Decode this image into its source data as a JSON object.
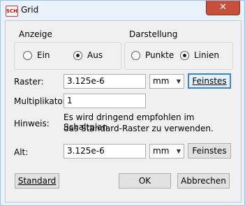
{
  "window": {
    "title": "Grid",
    "app_icon_text": "SCH",
    "close_symbol": "✕"
  },
  "anzeige": {
    "title": "Anzeige",
    "option_ein": "Ein",
    "option_aus": "Aus",
    "selected": "Aus"
  },
  "darstellung": {
    "title": "Darstellung",
    "option_punkte": "Punkte",
    "option_linien": "Linien",
    "selected": "Linien"
  },
  "raster": {
    "label": "Raster:",
    "value": "3.125e-6",
    "unit": "mm",
    "button": "Feinstes"
  },
  "multiplikator": {
    "label": "Multiplikator:",
    "value": "1"
  },
  "hinweis": {
    "label": "Hinweis:",
    "line1": "Es wird dringend empfohlen im Schaltplan",
    "line2": "das Standard-Raster zu verwenden."
  },
  "alt": {
    "label": "Alt:",
    "value": "3.125e-6",
    "unit": "mm",
    "button": "Feinstes"
  },
  "footer": {
    "standard": "Standard",
    "ok": "OK",
    "cancel": "Abbrechen"
  },
  "colors": {
    "close_button": "#c7503d",
    "focus_border": "#3a84d8"
  }
}
